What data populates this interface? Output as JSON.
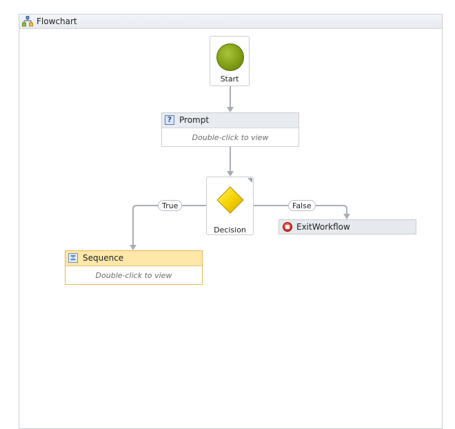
{
  "panel": {
    "title": "Flowchart",
    "icon": "flowchart-icon"
  },
  "nodes": {
    "start": {
      "label": "Start",
      "icon": "start-circle-icon",
      "color": "#7c9a12"
    },
    "prompt": {
      "title": "Prompt",
      "hint": "Double-click to view",
      "icon": "prompt-activity-icon"
    },
    "decision": {
      "label": "Decision",
      "icon": "decision-diamond-icon",
      "color": "#f5d400"
    },
    "sequence": {
      "title": "Sequence",
      "hint": "Double-click to view",
      "icon": "sequence-icon",
      "color": "#fde7a9"
    },
    "exit_workflow": {
      "title": "ExitWorkflow",
      "icon": "stop-icon",
      "color": "#d0180e"
    }
  },
  "branches": {
    "true_label": "True",
    "false_label": "False"
  }
}
